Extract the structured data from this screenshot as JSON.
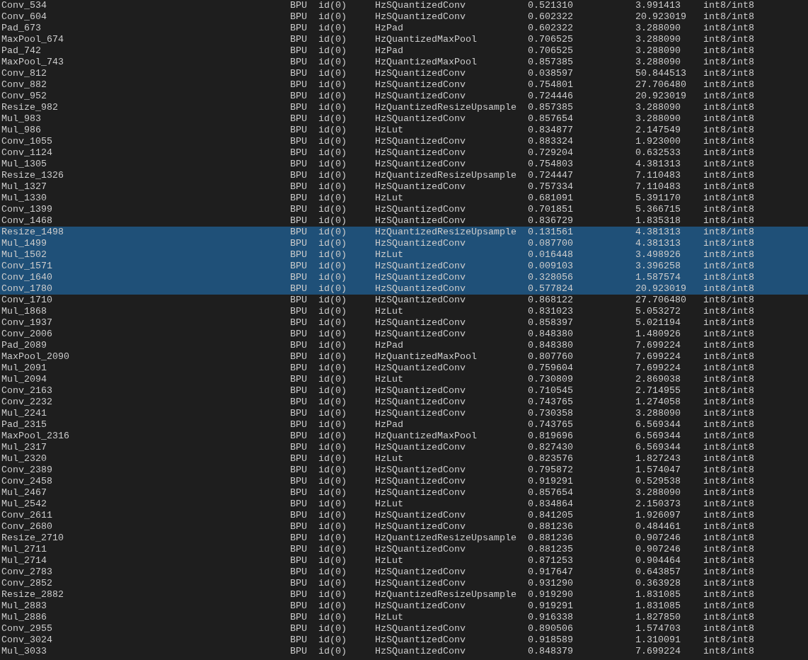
{
  "rows": [
    {
      "cells": [
        "Conv_534",
        "BPU",
        "id(0)",
        "HzSQuantizedConv",
        "0.521310",
        "3.991413",
        "int8/int8"
      ],
      "selected": false
    },
    {
      "cells": [
        "Conv_604",
        "BPU",
        "id(0)",
        "HzSQuantizedConv",
        "0.602322",
        "20.923019",
        "int8/int8"
      ],
      "selected": false
    },
    {
      "cells": [
        "Pad_673",
        "BPU",
        "id(0)",
        "HzPad",
        "0.602322",
        "3.288090",
        "int8/int8"
      ],
      "selected": false
    },
    {
      "cells": [
        "MaxPool_674",
        "BPU",
        "id(0)",
        "HzQuantizedMaxPool",
        "0.706525",
        "3.288090",
        "int8/int8"
      ],
      "selected": false
    },
    {
      "cells": [
        "Pad_742",
        "BPU",
        "id(0)",
        "HzPad",
        "0.706525",
        "3.288090",
        "int8/int8"
      ],
      "selected": false
    },
    {
      "cells": [
        "MaxPool_743",
        "BPU",
        "id(0)",
        "HzQuantizedMaxPool",
        "0.857385",
        "3.288090",
        "int8/int8"
      ],
      "selected": false
    },
    {
      "cells": [
        "Conv_812",
        "BPU",
        "id(0)",
        "HzSQuantizedConv",
        "0.038597",
        "50.844513",
        "int8/int8"
      ],
      "selected": false
    },
    {
      "cells": [
        "Conv_882",
        "BPU",
        "id(0)",
        "HzSQuantizedConv",
        "0.754801",
        "27.706480",
        "int8/int8"
      ],
      "selected": false
    },
    {
      "cells": [
        "Conv_952",
        "BPU",
        "id(0)",
        "HzSQuantizedConv",
        "0.724446",
        "20.923019",
        "int8/int8"
      ],
      "selected": false
    },
    {
      "cells": [
        "Resize_982",
        "BPU",
        "id(0)",
        "HzQuantizedResizeUpsample",
        "0.857385",
        "3.288090",
        "int8/int8"
      ],
      "selected": false
    },
    {
      "cells": [
        "Mul_983",
        "BPU",
        "id(0)",
        "HzSQuantizedConv",
        "0.857654",
        "3.288090",
        "int8/int8"
      ],
      "selected": false
    },
    {
      "cells": [
        "Mul_986",
        "BPU",
        "id(0)",
        "HzLut",
        "0.834877",
        "2.147549",
        "int8/int8"
      ],
      "selected": false
    },
    {
      "cells": [
        "Conv_1055",
        "BPU",
        "id(0)",
        "HzSQuantizedConv",
        "0.883324",
        "1.923000",
        "int8/int8"
      ],
      "selected": false
    },
    {
      "cells": [
        "Conv_1124",
        "BPU",
        "id(0)",
        "HzSQuantizedConv",
        "0.729204",
        "0.632533",
        "int8/int8"
      ],
      "selected": false
    },
    {
      "cells": [
        "Mul_1305",
        "BPU",
        "id(0)",
        "HzSQuantizedConv",
        "0.754803",
        "4.381313",
        "int8/int8"
      ],
      "selected": false
    },
    {
      "cells": [
        "Resize_1326",
        "BPU",
        "id(0)",
        "HzQuantizedResizeUpsample",
        "0.724447",
        "7.110483",
        "int8/int8"
      ],
      "selected": false
    },
    {
      "cells": [
        "Mul_1327",
        "BPU",
        "id(0)",
        "HzSQuantizedConv",
        "0.757334",
        "7.110483",
        "int8/int8"
      ],
      "selected": false
    },
    {
      "cells": [
        "Mul_1330",
        "BPU",
        "id(0)",
        "HzLut",
        "0.681091",
        "5.391170",
        "int8/int8"
      ],
      "selected": false
    },
    {
      "cells": [
        "Conv_1399",
        "BPU",
        "id(0)",
        "HzSQuantizedConv",
        "0.701851",
        "5.366715",
        "int8/int8"
      ],
      "selected": false
    },
    {
      "cells": [
        "Conv_1468",
        "BPU",
        "id(0)",
        "HzSQuantizedConv",
        "0.836729",
        "1.835318",
        "int8/int8"
      ],
      "selected": false
    },
    {
      "cells": [
        "Resize_1498",
        "BPU",
        "id(0)",
        "HzQuantizedResizeUpsample",
        "0.131561",
        "4.381313",
        "int8/int8"
      ],
      "selected": true
    },
    {
      "cells": [
        "Mul_1499",
        "BPU",
        "id(0)",
        "HzSQuantizedConv",
        "0.087700",
        "4.381313",
        "int8/int8"
      ],
      "selected": true
    },
    {
      "cells": [
        "Mul_1502",
        "BPU",
        "id(0)",
        "HzLut",
        "0.016448",
        "3.498926",
        "int8/int8"
      ],
      "selected": true
    },
    {
      "cells": [
        "Conv_1571",
        "BPU",
        "id(0)",
        "HzSQuantizedConv",
        "0.009103",
        "3.396258",
        "int8/int8"
      ],
      "selected": true
    },
    {
      "cells": [
        "Conv_1640",
        "BPU",
        "id(0)",
        "HzSQuantizedConv",
        "0.328056",
        "1.587574",
        "int8/int8"
      ],
      "selected": true
    },
    {
      "cells": [
        "Conv_1780",
        "BPU",
        "id(0)",
        "HzSQuantizedConv",
        "0.577824",
        "20.923019",
        "int8/int8"
      ],
      "selected": true
    },
    {
      "cells": [
        "Conv_1710",
        "BPU",
        "id(0)",
        "HzSQuantizedConv",
        "0.868122",
        "27.706480",
        "int8/int8"
      ],
      "selected": false
    },
    {
      "cells": [
        "Mul_1868",
        "BPU",
        "id(0)",
        "HzLut",
        "0.831023",
        "5.053272",
        "int8/int8"
      ],
      "selected": false
    },
    {
      "cells": [
        "Conv_1937",
        "BPU",
        "id(0)",
        "HzSQuantizedConv",
        "0.858397",
        "5.021194",
        "int8/int8"
      ],
      "selected": false
    },
    {
      "cells": [
        "Conv_2006",
        "BPU",
        "id(0)",
        "HzSQuantizedConv",
        "0.848380",
        "1.480926",
        "int8/int8"
      ],
      "selected": false
    },
    {
      "cells": [
        "Pad_2089",
        "BPU",
        "id(0)",
        "HzPad",
        "0.848380",
        "7.699224",
        "int8/int8"
      ],
      "selected": false
    },
    {
      "cells": [
        "MaxPool_2090",
        "BPU",
        "id(0)",
        "HzQuantizedMaxPool",
        "0.807760",
        "7.699224",
        "int8/int8"
      ],
      "selected": false
    },
    {
      "cells": [
        "Mul_2091",
        "BPU",
        "id(0)",
        "HzSQuantizedConv",
        "0.759604",
        "7.699224",
        "int8/int8"
      ],
      "selected": false
    },
    {
      "cells": [
        "Mul_2094",
        "BPU",
        "id(0)",
        "HzLut",
        "0.730809",
        "2.869038",
        "int8/int8"
      ],
      "selected": false
    },
    {
      "cells": [
        "Conv_2163",
        "BPU",
        "id(0)",
        "HzSQuantizedConv",
        "0.710545",
        "2.714955",
        "int8/int8"
      ],
      "selected": false
    },
    {
      "cells": [
        "Conv_2232",
        "BPU",
        "id(0)",
        "HzSQuantizedConv",
        "0.743765",
        "1.274058",
        "int8/int8"
      ],
      "selected": false
    },
    {
      "cells": [
        "Mul_2241",
        "BPU",
        "id(0)",
        "HzSQuantizedConv",
        "0.730358",
        "3.288090",
        "int8/int8"
      ],
      "selected": false
    },
    {
      "cells": [
        "Pad_2315",
        "BPU",
        "id(0)",
        "HzPad",
        "0.743765",
        "6.569344",
        "int8/int8"
      ],
      "selected": false
    },
    {
      "cells": [
        "MaxPool_2316",
        "BPU",
        "id(0)",
        "HzQuantizedMaxPool",
        "0.819696",
        "6.569344",
        "int8/int8"
      ],
      "selected": false
    },
    {
      "cells": [
        "Mul_2317",
        "BPU",
        "id(0)",
        "HzSQuantizedConv",
        "0.827430",
        "6.569344",
        "int8/int8"
      ],
      "selected": false
    },
    {
      "cells": [
        "Mul_2320",
        "BPU",
        "id(0)",
        "HzLut",
        "0.823576",
        "1.827243",
        "int8/int8"
      ],
      "selected": false
    },
    {
      "cells": [
        "Conv_2389",
        "BPU",
        "id(0)",
        "HzSQuantizedConv",
        "0.795872",
        "1.574047",
        "int8/int8"
      ],
      "selected": false
    },
    {
      "cells": [
        "Conv_2458",
        "BPU",
        "id(0)",
        "HzSQuantizedConv",
        "0.919291",
        "0.529538",
        "int8/int8"
      ],
      "selected": false
    },
    {
      "cells": [
        "Mul_2467",
        "BPU",
        "id(0)",
        "HzSQuantizedConv",
        "0.857654",
        "3.288090",
        "int8/int8"
      ],
      "selected": false
    },
    {
      "cells": [
        "Mul_2542",
        "BPU",
        "id(0)",
        "HzLut",
        "0.834864",
        "2.150373",
        "int8/int8"
      ],
      "selected": false
    },
    {
      "cells": [
        "Conv_2611",
        "BPU",
        "id(0)",
        "HzSQuantizedConv",
        "0.841205",
        "1.926097",
        "int8/int8"
      ],
      "selected": false
    },
    {
      "cells": [
        "Conv_2680",
        "BPU",
        "id(0)",
        "HzSQuantizedConv",
        "0.881236",
        "0.484461",
        "int8/int8"
      ],
      "selected": false
    },
    {
      "cells": [
        "Resize_2710",
        "BPU",
        "id(0)",
        "HzQuantizedResizeUpsample",
        "0.881236",
        "0.907246",
        "int8/int8"
      ],
      "selected": false
    },
    {
      "cells": [
        "Mul_2711",
        "BPU",
        "id(0)",
        "HzSQuantizedConv",
        "0.881235",
        "0.907246",
        "int8/int8"
      ],
      "selected": false
    },
    {
      "cells": [
        "Mul_2714",
        "BPU",
        "id(0)",
        "HzLut",
        "0.871253",
        "0.904464",
        "int8/int8"
      ],
      "selected": false
    },
    {
      "cells": [
        "Conv_2783",
        "BPU",
        "id(0)",
        "HzSQuantizedConv",
        "0.917647",
        "0.643857",
        "int8/int8"
      ],
      "selected": false
    },
    {
      "cells": [
        "Conv_2852",
        "BPU",
        "id(0)",
        "HzSQuantizedConv",
        "0.931290",
        "0.363928",
        "int8/int8"
      ],
      "selected": false
    },
    {
      "cells": [
        "Resize_2882",
        "BPU",
        "id(0)",
        "HzQuantizedResizeUpsample",
        "0.919290",
        "1.831085",
        "int8/int8"
      ],
      "selected": false
    },
    {
      "cells": [
        "Mul_2883",
        "BPU",
        "id(0)",
        "HzSQuantizedConv",
        "0.919291",
        "1.831085",
        "int8/int8"
      ],
      "selected": false
    },
    {
      "cells": [
        "Mul_2886",
        "BPU",
        "id(0)",
        "HzLut",
        "0.916338",
        "1.827850",
        "int8/int8"
      ],
      "selected": false
    },
    {
      "cells": [
        "Conv_2955",
        "BPU",
        "id(0)",
        "HzSQuantizedConv",
        "0.890506",
        "1.574703",
        "int8/int8"
      ],
      "selected": false
    },
    {
      "cells": [
        "Conv_3024",
        "BPU",
        "id(0)",
        "HzSQuantizedConv",
        "0.918589",
        "1.310091",
        "int8/int8"
      ],
      "selected": false
    },
    {
      "cells": [
        "Mul_3033",
        "BPU",
        "id(0)",
        "HzSQuantizedConv",
        "0.848379",
        "7.699224",
        "int8/int8"
      ],
      "selected": false
    }
  ]
}
